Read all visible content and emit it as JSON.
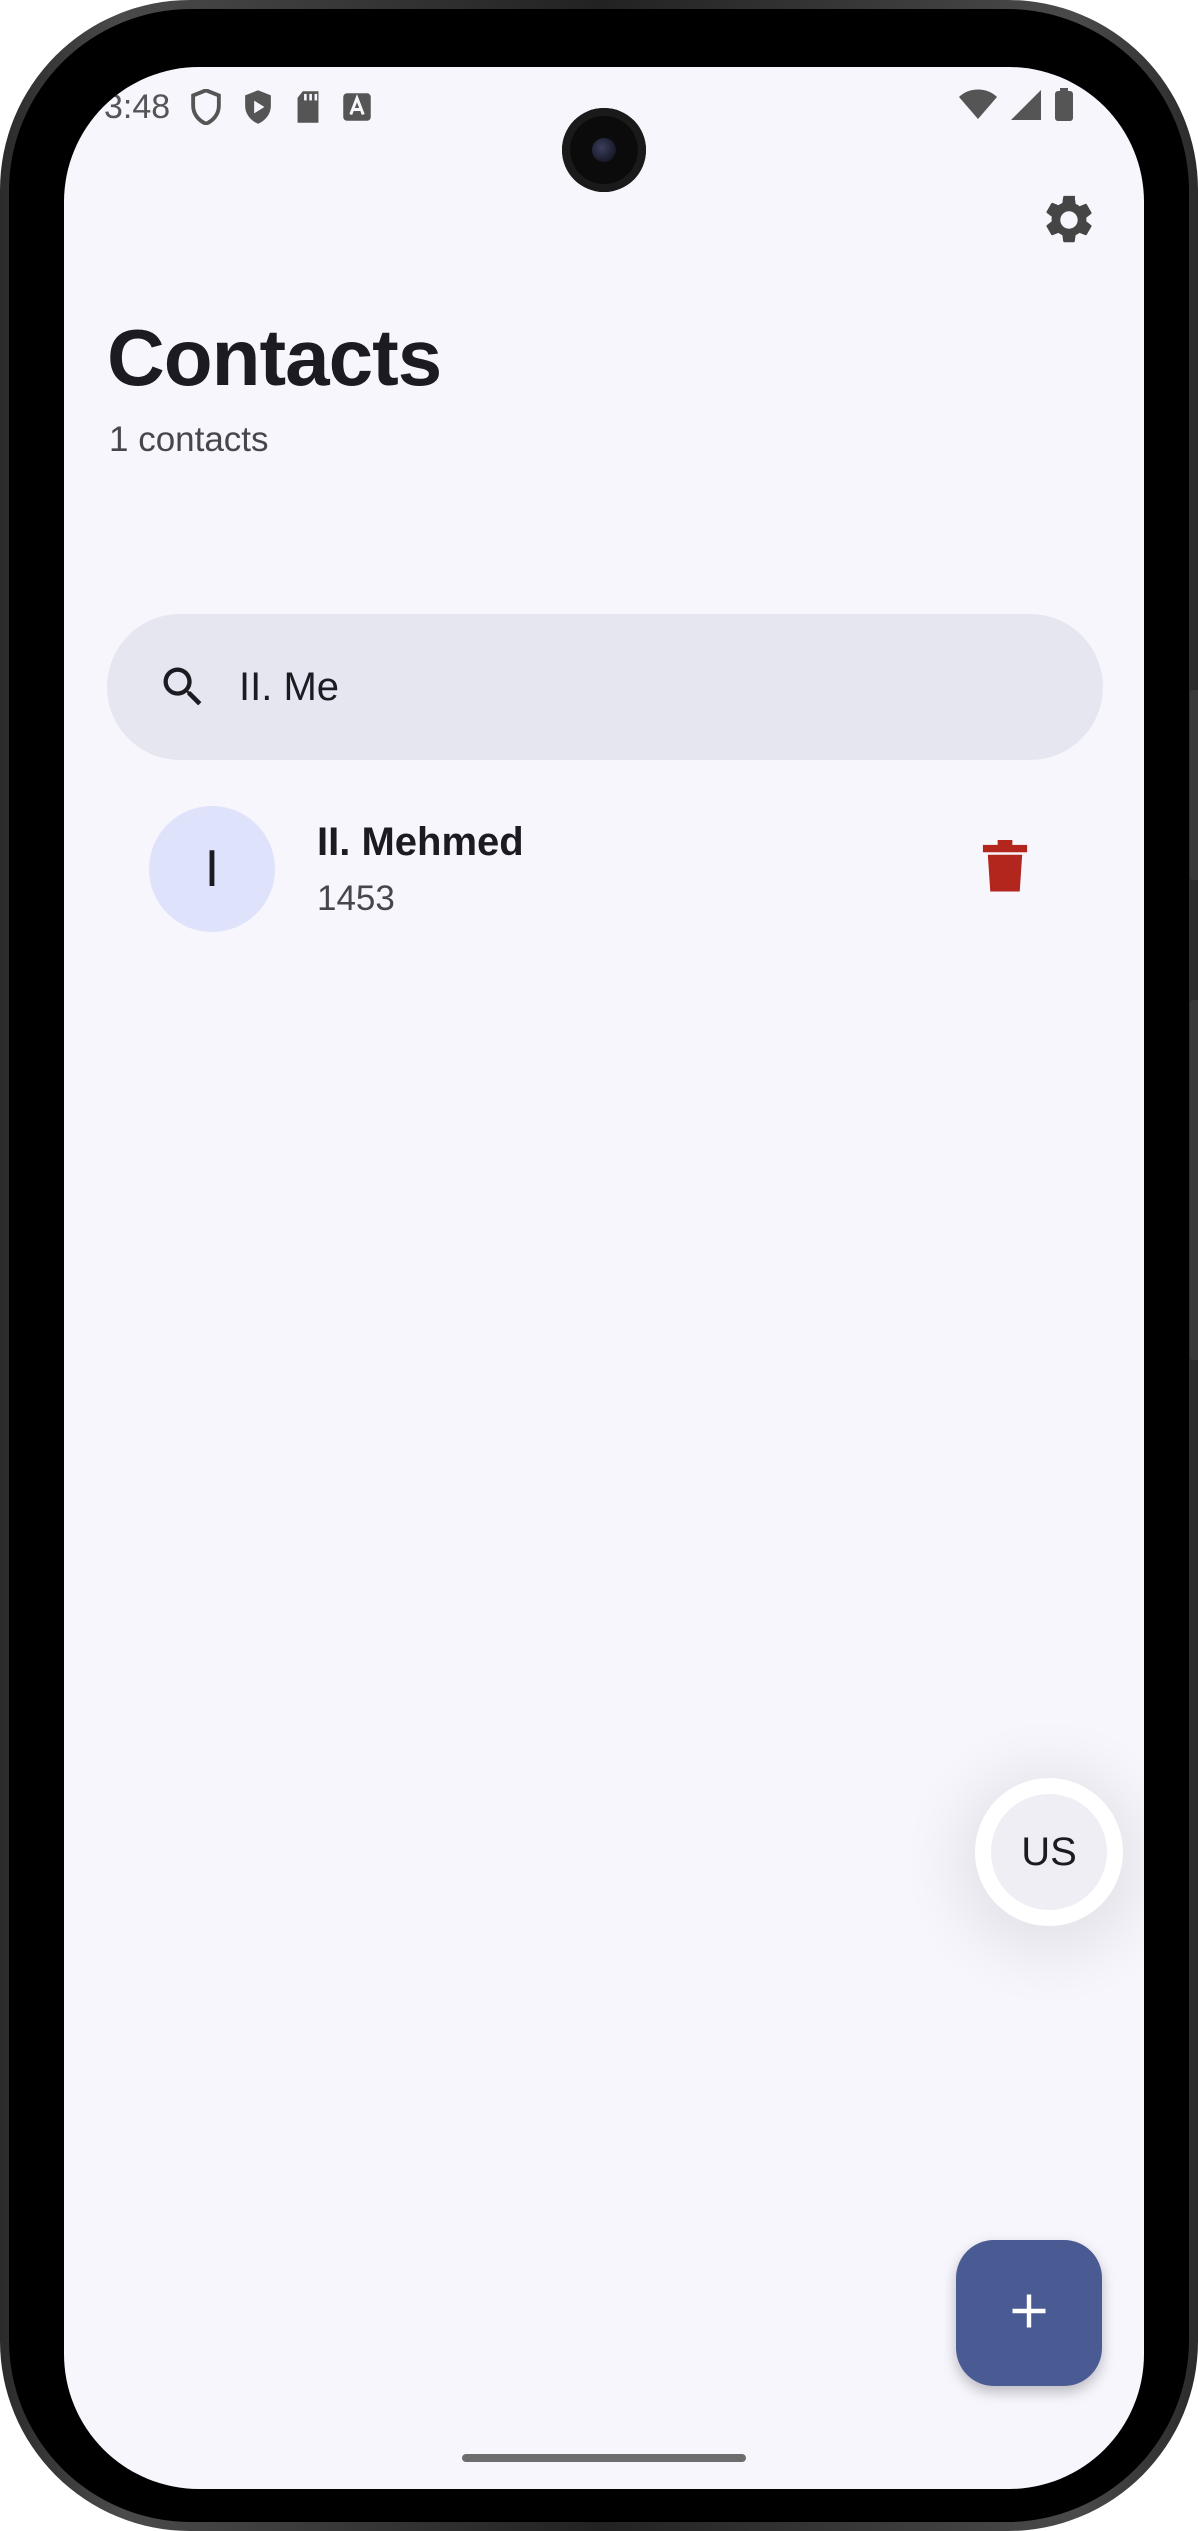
{
  "status_bar": {
    "time": "3:48",
    "icons_left": [
      "shield-icon",
      "play-protect-icon",
      "sd-card-icon",
      "font-a-icon"
    ],
    "icons_right": [
      "wifi-icon",
      "signal-icon",
      "battery-icon"
    ]
  },
  "header": {
    "title": "Contacts",
    "subtitle": "1 contacts"
  },
  "search": {
    "value": "II. Me",
    "icon": "search-icon"
  },
  "contacts": [
    {
      "initial": "I",
      "name": "II. Mehmed",
      "number": "1453"
    }
  ],
  "language_bubble": {
    "label": "US"
  },
  "fab": {
    "label": "+"
  },
  "colors": {
    "background": "#f7f6fd",
    "search_bg": "#e6e6f0",
    "avatar_bg": "#dee3fb",
    "delete": "#b3261e",
    "fab": "#4a5b94",
    "text_primary": "#1b1b21",
    "text_secondary": "#46464f"
  }
}
